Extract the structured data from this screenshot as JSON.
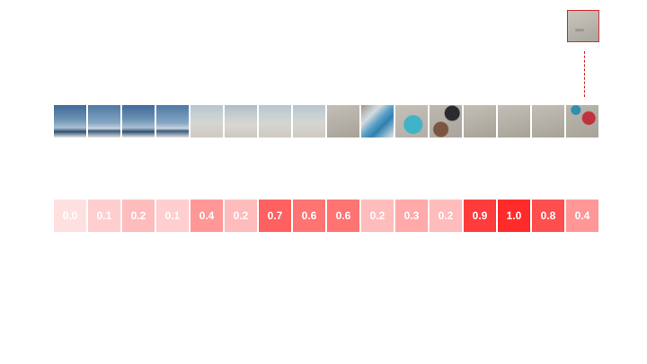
{
  "selected_index": 15,
  "colors": {
    "accent": "#d32f2f",
    "score_max": "#ff2a2a",
    "score_min": "#ffe0e0"
  },
  "frames": [
    {
      "icon": "ocean-frame"
    },
    {
      "icon": "ocean-frame"
    },
    {
      "icon": "ocean-frame"
    },
    {
      "icon": "ocean-frame"
    },
    {
      "icon": "beach-frame"
    },
    {
      "icon": "beach-people-frame"
    },
    {
      "icon": "beach-frame"
    },
    {
      "icon": "beach-frame"
    },
    {
      "icon": "sand-frame"
    },
    {
      "icon": "towel-frame"
    },
    {
      "icon": "surfboard-frame"
    },
    {
      "icon": "bag-frame"
    },
    {
      "icon": "sand-frame"
    },
    {
      "icon": "sand-frame"
    },
    {
      "icon": "sand-frame"
    },
    {
      "icon": "sand-objects-frame"
    }
  ],
  "scores": [
    {
      "label": "0.0",
      "value": 0.0
    },
    {
      "label": "0.1",
      "value": 0.1
    },
    {
      "label": "0.2",
      "value": 0.2
    },
    {
      "label": "0.1",
      "value": 0.1
    },
    {
      "label": "0.4",
      "value": 0.4
    },
    {
      "label": "0.2",
      "value": 0.2
    },
    {
      "label": "0.7",
      "value": 0.7
    },
    {
      "label": "0.6",
      "value": 0.6
    },
    {
      "label": "0.6",
      "value": 0.6
    },
    {
      "label": "0.2",
      "value": 0.2
    },
    {
      "label": "0.3",
      "value": 0.3
    },
    {
      "label": "0.2",
      "value": 0.2
    },
    {
      "label": "0.9",
      "value": 0.9
    },
    {
      "label": "1.0",
      "value": 1.0
    },
    {
      "label": "0.8",
      "value": 0.8
    },
    {
      "label": "0.4",
      "value": 0.4
    }
  ]
}
